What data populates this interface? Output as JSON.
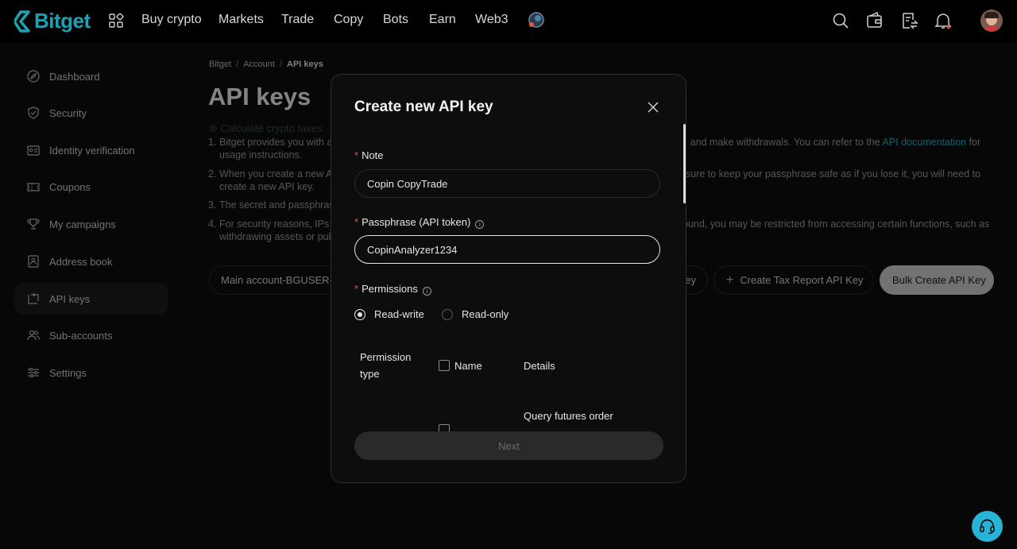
{
  "nav": {
    "logo": "Bitget",
    "items": [
      "Buy crypto",
      "Markets",
      "Trade",
      "Copy",
      "Bots",
      "Earn",
      "Web3"
    ]
  },
  "sidebar": {
    "items": [
      {
        "label": "Dashboard",
        "icon": "dashboard-icon"
      },
      {
        "label": "Security",
        "icon": "shield-icon"
      },
      {
        "label": "Identity verification",
        "icon": "id-card-icon"
      },
      {
        "label": "Coupons",
        "icon": "coupon-icon"
      },
      {
        "label": "My campaigns",
        "icon": "trophy-icon"
      },
      {
        "label": "Address book",
        "icon": "address-book-icon"
      },
      {
        "label": "API keys",
        "icon": "api-key-icon",
        "active": true
      },
      {
        "label": "Sub-accounts",
        "icon": "users-icon"
      },
      {
        "label": "Settings",
        "icon": "sliders-icon"
      }
    ]
  },
  "breadcrumb": {
    "root": "Bitget",
    "parent": "Account",
    "current": "API keys"
  },
  "page": {
    "title": "API keys",
    "tax_link": "Calculate crypto taxes",
    "notes": [
      {
        "num": "1.",
        "a": "Bitget provides you with a",
        "b": "ts, and make withdrawals. You can refer to the ",
        "link": "API documentation",
        "c": " for",
        "d": "usage instructions."
      },
      {
        "num": "2.",
        "a": "When you create a new A",
        "b": "sure to keep your passphrase safe as if you lose it, you will need to",
        "d": "create a new API key."
      },
      {
        "num": "3.",
        "a": "The secret and passphras"
      },
      {
        "num": "4.",
        "a": "For security reasons, IPs",
        "b": "ound, you may be restricted from accessing certain functions, such as",
        "d": "withdrawing assets or pul"
      }
    ],
    "account_pill": "Main account-BGUSER-",
    "btn_partial": "ey",
    "btn_tax": "Create Tax Report API Key",
    "btn_bulk": "Bulk Create API Key"
  },
  "modal": {
    "title": "Create new API key",
    "note_label": "Note",
    "note_value": "Copin CopyTrade",
    "passphrase_label": "Passphrase (API token)",
    "passphrase_value": "CopinAnalyzer1234",
    "permissions_label": "Permissions",
    "radio_rw": "Read-write",
    "radio_ro": "Read-only",
    "col_type": "Permission type",
    "col_name": "Name",
    "col_details": "Details",
    "row1_details": "Query futures order",
    "next": "Next"
  },
  "colors": {
    "brand": "#1da2b4",
    "support": "#27b4d6",
    "required": "#e0593b"
  }
}
